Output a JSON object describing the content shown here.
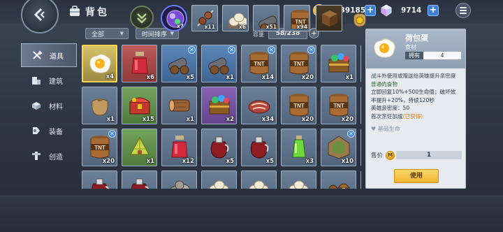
{
  "header": {
    "title": "背包",
    "gold": "6939185",
    "gems": "9714",
    "colors": {
      "accent": "#3e7fd6",
      "gold": "#e5a51a"
    }
  },
  "sidebar": {
    "items": [
      {
        "label": "道具",
        "icon": "tools-icon",
        "active": true
      },
      {
        "label": "建筑",
        "icon": "building-icon",
        "active": false
      },
      {
        "label": "材料",
        "icon": "materials-icon",
        "active": false
      },
      {
        "label": "装备",
        "icon": "equipment-icon",
        "active": false
      },
      {
        "label": "创造",
        "icon": "create-icon",
        "active": false
      }
    ]
  },
  "filters": {
    "category": "全部",
    "sort": "时间排序",
    "capacity_label": "容量",
    "capacity_value": "58/238"
  },
  "grid": [
    {
      "item": "fried-egg",
      "count": "x4",
      "selected": true,
      "new": false,
      "rarity": "selected"
    },
    {
      "item": "red-potion",
      "count": "x6",
      "new": false,
      "rarity": "red"
    },
    {
      "item": "cannon",
      "count": "x5",
      "new": true,
      "rarity": "blue"
    },
    {
      "item": "cannon",
      "count": "x1",
      "new": true,
      "rarity": "blue"
    },
    {
      "item": "tnt-barrel",
      "count": "x14",
      "new": true,
      "rarity": "plain"
    },
    {
      "item": "tnt-barrel",
      "count": "x20",
      "new": true,
      "rarity": "plain"
    },
    {
      "item": "gem-chest",
      "count": "x1",
      "new": false,
      "rarity": "plain"
    },
    {
      "item": "empty",
      "count": "",
      "new": false,
      "rarity": "none"
    },
    {
      "item": "sack",
      "count": "x1",
      "new": false,
      "rarity": "plain"
    },
    {
      "item": "treasure-chest",
      "count": "x15",
      "new": false,
      "rarity": "green"
    },
    {
      "item": "wood-log",
      "count": "x1",
      "new": false,
      "rarity": "plain"
    },
    {
      "item": "gem-chest",
      "count": "x2",
      "new": false,
      "rarity": "purple"
    },
    {
      "item": "meat",
      "count": "x34",
      "new": false,
      "rarity": "plain"
    },
    {
      "item": "tnt-barrel",
      "count": "x20",
      "new": false,
      "rarity": "plain"
    },
    {
      "item": "tnt-barrel",
      "count": "x20",
      "new": false,
      "rarity": "plain"
    },
    {
      "item": "empty",
      "count": "",
      "new": false,
      "rarity": "none"
    },
    {
      "item": "tnt-barrel",
      "count": "x20",
      "new": true,
      "rarity": "plain"
    },
    {
      "item": "herb-bundle",
      "count": "x1",
      "new": false,
      "rarity": "green"
    },
    {
      "item": "red-potion",
      "count": "x12",
      "new": false,
      "rarity": "plain"
    },
    {
      "item": "red-jug",
      "count": "x5",
      "new": false,
      "rarity": "plain"
    },
    {
      "item": "red-jug",
      "count": "x5",
      "new": false,
      "rarity": "plain"
    },
    {
      "item": "green-potion",
      "count": "x3",
      "new": false,
      "rarity": "plain"
    },
    {
      "item": "wood-frame",
      "count": "x10",
      "new": true,
      "rarity": "plain"
    },
    {
      "item": "empty",
      "count": "",
      "new": false,
      "rarity": "none"
    },
    {
      "item": "red-jug",
      "count": "",
      "new": false,
      "rarity": "plain"
    },
    {
      "item": "red-jug",
      "count": "",
      "new": false,
      "rarity": "plain"
    },
    {
      "item": "stone-pile",
      "count": "",
      "new": false,
      "rarity": "plain"
    },
    {
      "item": "dumplings",
      "count": "",
      "new": false,
      "rarity": "plain"
    },
    {
      "item": "dumplings",
      "count": "",
      "new": false,
      "rarity": "plain"
    },
    {
      "item": "dumplings",
      "count": "",
      "new": false,
      "rarity": "plain"
    },
    {
      "item": "mushrooms",
      "count": "",
      "new": false,
      "rarity": "plain"
    },
    {
      "item": "empty",
      "count": "",
      "new": false,
      "rarity": "none"
    }
  ],
  "detail": {
    "name": "荷包蛋",
    "type": "食材",
    "own_label": "拥有",
    "own_value": "4",
    "desc": "战斗外使用或赠送给英雄提升亲密度",
    "quality": "普通的食物",
    "effect": "立即回复10%+500生命值；破坏效率提升+20%，持续120秒",
    "affinity": "英雄亲密度：50",
    "first_cook": "首次烹饪加成",
    "obtained": "(已获得)",
    "heal_label": "基础生命",
    "price_label": "售价",
    "price_value": "1",
    "use_label": "使用"
  },
  "hotbar": [
    {
      "item": "magic-orb",
      "count": "x7"
    },
    {
      "item": "skewer",
      "count": "x11"
    },
    {
      "item": "dumplings",
      "count": "x6"
    },
    {
      "item": "cannon",
      "count": "x51"
    },
    {
      "item": "tnt-barrel",
      "count": "x94"
    },
    {
      "item": "wood-block",
      "count": ""
    },
    {
      "item": "coin-bag",
      "count": ""
    }
  ]
}
